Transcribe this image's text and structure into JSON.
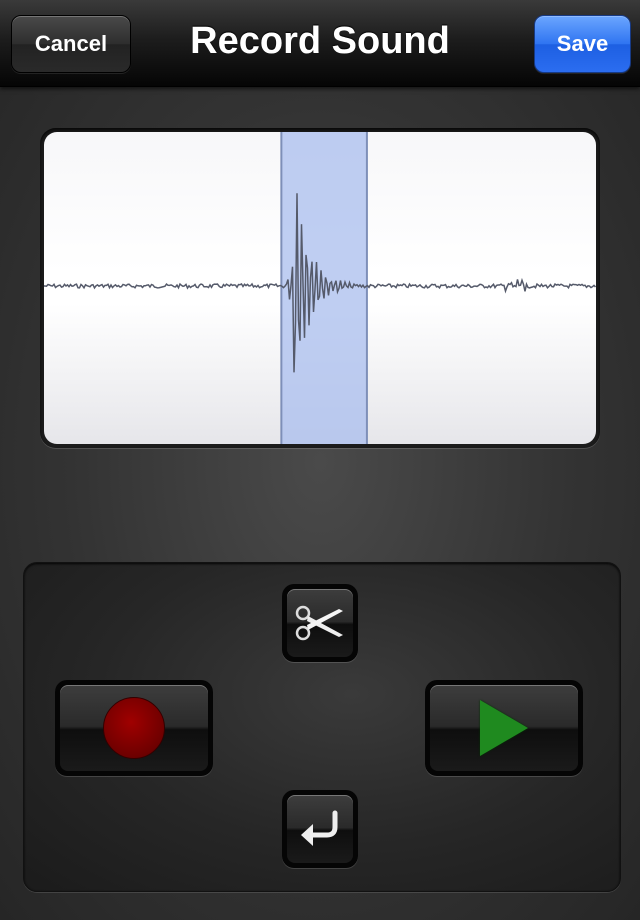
{
  "navbar": {
    "title": "Record Sound",
    "cancel_label": "Cancel",
    "save_label": "Save"
  },
  "waveform": {
    "selection_start": 0.43,
    "selection_end": 0.585
  },
  "controls": {
    "record_icon": "record-icon",
    "play_icon": "play-icon",
    "trim_icon": "scissors-icon",
    "undo_icon": "undo-arrow-icon"
  },
  "colors": {
    "save_button": "#2f74f1",
    "selection": "#a9bdee",
    "record": "#7a0000",
    "play": "#1f8a1f",
    "waveform": "#555a6a"
  }
}
